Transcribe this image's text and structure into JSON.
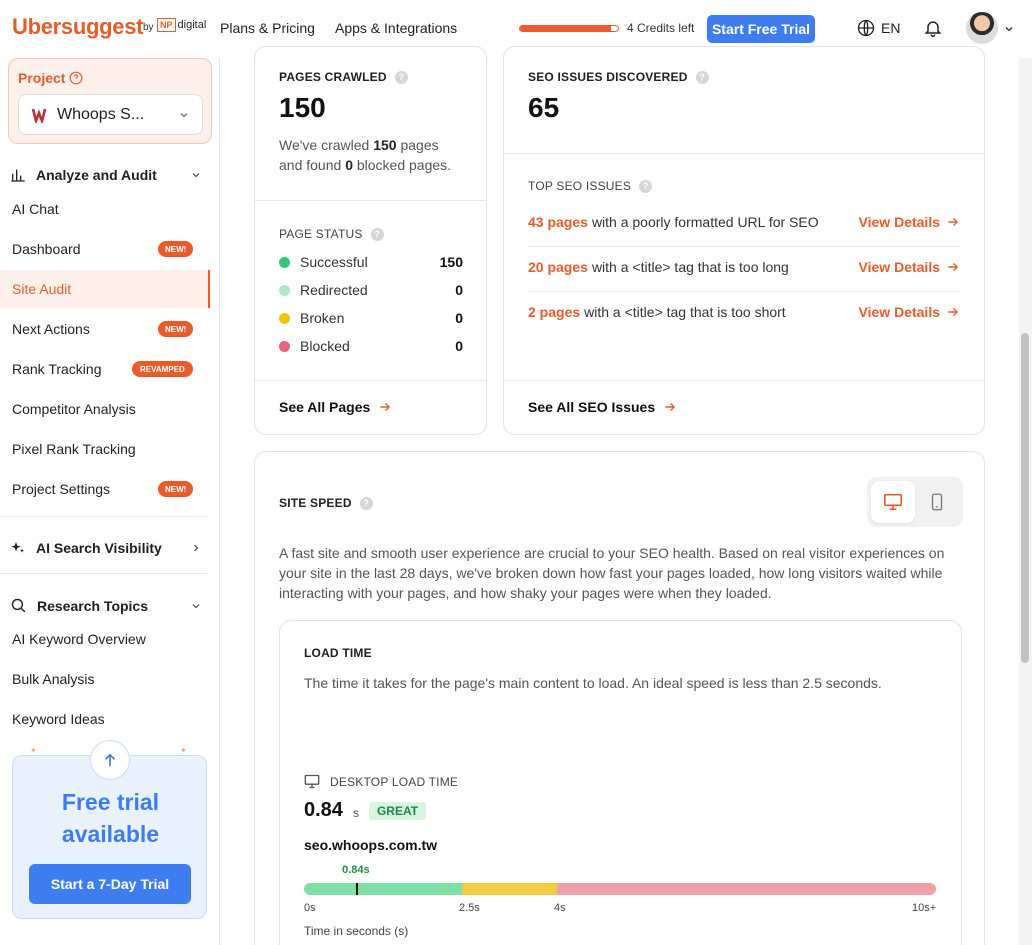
{
  "header": {
    "logo": "Ubersuggest",
    "by": "by",
    "np_mark": "NP",
    "np_text": "digital",
    "nav": [
      "Plans & Pricing",
      "Apps & Integrations"
    ],
    "credits_text": "4 Credits left",
    "credits_fraction": 0.93,
    "trial_button": "Start Free Trial",
    "language": "EN"
  },
  "sidebar": {
    "project_label": "Project",
    "project_name": "Whoops S...",
    "sections": [
      {
        "label": "Analyze and Audit"
      },
      {
        "label": "AI Search Visibility"
      },
      {
        "label": "Research Topics"
      }
    ],
    "analyze_items": [
      {
        "label": "AI Chat",
        "badge": ""
      },
      {
        "label": "Dashboard",
        "badge": "NEW!"
      },
      {
        "label": "Site Audit",
        "badge": ""
      },
      {
        "label": "Next Actions",
        "badge": "NEW!"
      },
      {
        "label": "Rank Tracking",
        "badge": "REVAMPED"
      },
      {
        "label": "Competitor Analysis",
        "badge": ""
      },
      {
        "label": "Pixel Rank Tracking",
        "badge": ""
      },
      {
        "label": "Project Settings",
        "badge": "NEW!"
      }
    ],
    "research_items": [
      {
        "label": "AI Keyword Overview"
      },
      {
        "label": "Bulk Analysis"
      },
      {
        "label": "Keyword Ideas"
      }
    ],
    "trial_card": {
      "title_line1": "Free trial",
      "title_line2": "available",
      "cta": "Start a 7-Day Trial"
    }
  },
  "pages_crawled": {
    "title": "PAGES CRAWLED",
    "value": "150",
    "desc_pre": "We've crawled",
    "desc_pages": "150",
    "desc_mid": "pages",
    "desc_line2_pre": "and found",
    "desc_blocked": "0",
    "desc_line2_post": "blocked pages.",
    "status_title": "PAGE STATUS",
    "statuses": [
      {
        "label": "Successful",
        "value": "150",
        "color": "#3cc17a"
      },
      {
        "label": "Redirected",
        "value": "0",
        "color": "#a8ecc7"
      },
      {
        "label": "Broken",
        "value": "0",
        "color": "#f2c216"
      },
      {
        "label": "Blocked",
        "value": "0",
        "color": "#e8627a"
      }
    ],
    "see_all": "See All Pages"
  },
  "seo_issues": {
    "title": "SEO ISSUES DISCOVERED",
    "value": "65",
    "top_title": "TOP SEO ISSUES",
    "issues": [
      {
        "count": "43 pages",
        "text": "with a poorly formatted URL for SEO",
        "action": "View Details"
      },
      {
        "count": "20 pages",
        "text": "with a <title> tag that is too long",
        "action": "View Details"
      },
      {
        "count": "2 pages",
        "text": "with a <title> tag that is too short",
        "action": "View Details"
      }
    ],
    "see_all": "See All SEO Issues"
  },
  "site_speed": {
    "title": "SITE SPEED",
    "description": "A fast site and smooth user experience are crucial to your SEO health. Based on real visitor experiences on your site in the last 28 days, we've broken down how fast your pages loaded, how long visitors waited while interacting with your pages, and how shaky your pages were when they loaded.",
    "load_time": {
      "title": "LOAD TIME",
      "description": "The time it takes for the page's main content to load. An ideal speed is less than 2.5 seconds.",
      "desktop_label": "DESKTOP LOAD TIME",
      "value": "0.84",
      "unit": "s",
      "rating": "GREAT",
      "domain": "seo.whoops.com.tw",
      "marker_label": "0.84s",
      "marker_value": 0.84,
      "ticks": [
        "0s",
        "2.5s",
        "4s",
        "10s+"
      ],
      "axis_label": "Time in seconds (s)",
      "colors": {
        "good": "#7ee0a5",
        "medium": "#f2cc3f",
        "poor": "#f2a0a8"
      }
    }
  },
  "colors": {
    "accent": "#ea5b2a",
    "primary": "#3d7df0"
  }
}
